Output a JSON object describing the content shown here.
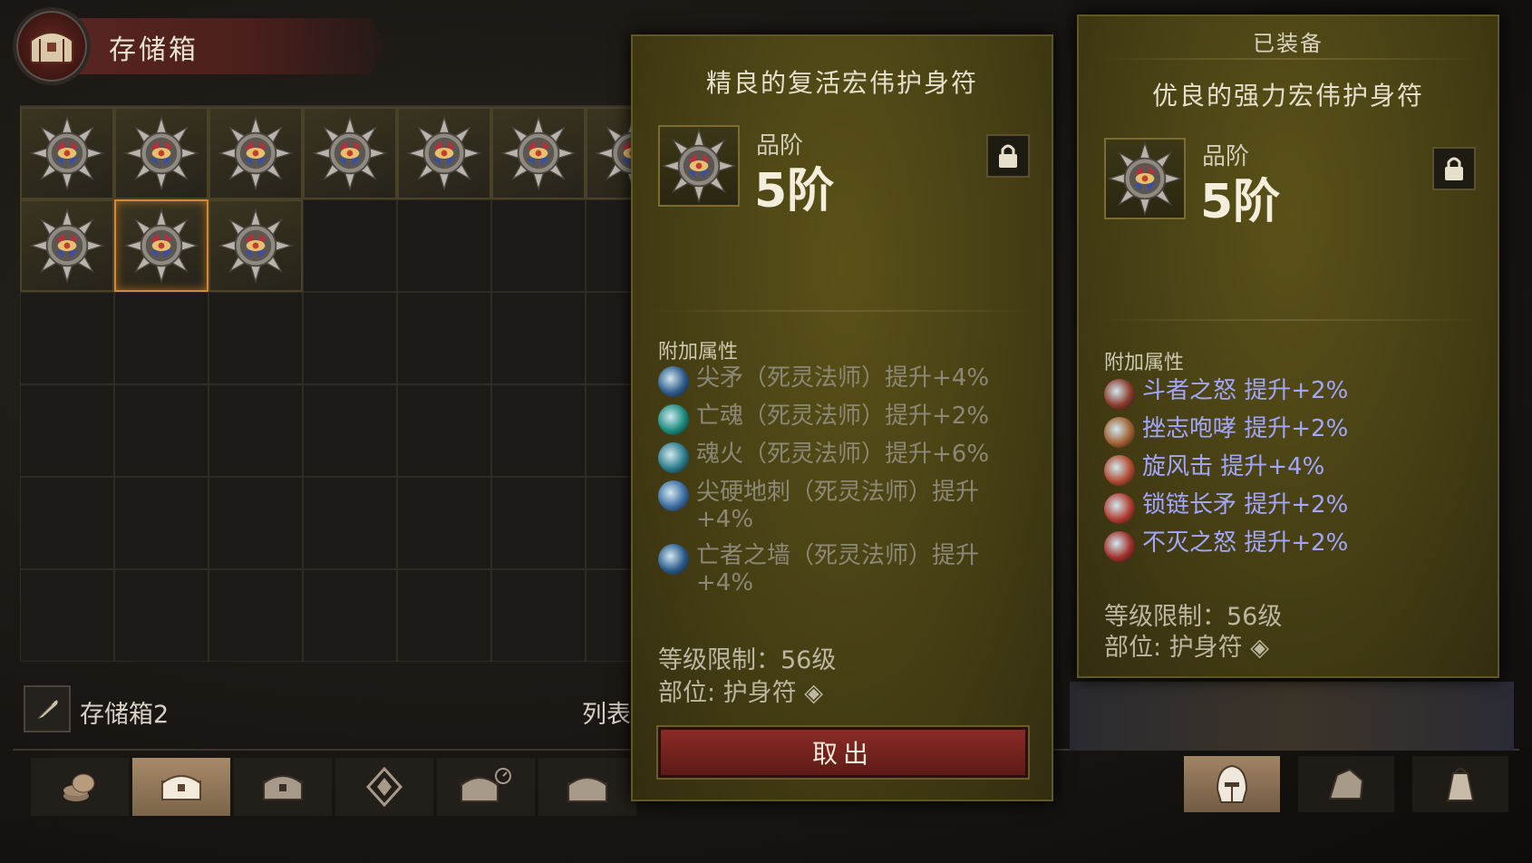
{
  "storage": {
    "title": "存储箱",
    "grid_rows": [
      [
        "amulet",
        "amulet",
        "amulet",
        "amulet",
        "amulet",
        "amulet",
        "amulet"
      ],
      [
        "amulet",
        "amulet-selected",
        "amulet",
        "empty",
        "empty",
        "empty",
        "empty"
      ]
    ],
    "footer_name": "存储箱2",
    "list_label": "列表"
  },
  "tabs": [
    {
      "icon": "coins-icon"
    },
    {
      "icon": "chest-icon",
      "active": true
    },
    {
      "icon": "chest-icon"
    },
    {
      "icon": "gem-icon"
    },
    {
      "icon": "chest-timer-icon"
    },
    {
      "icon": "chest-icon"
    }
  ],
  "equip_tabs": [
    {
      "icon": "helmet-icon",
      "active": true
    },
    {
      "icon": "ore-icon"
    },
    {
      "icon": "bag-icon"
    }
  ],
  "left_item": {
    "name": "精良的复活宏伟护身符",
    "tier_label": "品阶",
    "tier_value": "5阶",
    "attr_heading": "附加属性",
    "attributes": [
      {
        "icon": "spear-icon",
        "text": "尖矛（死灵法师）提升+4%"
      },
      {
        "icon": "soul-icon",
        "text": "亡魂（死灵法师）提升+2%"
      },
      {
        "icon": "soulfire-icon",
        "text": "魂火（死灵法师）提升+6%"
      },
      {
        "icon": "ground-spike-icon",
        "text": "尖硬地刺（死灵法师）提升+4%"
      },
      {
        "icon": "bone-wall-icon",
        "text": "亡者之墙（死灵法师）提升+4%"
      }
    ],
    "level_req": "等级限制：56级",
    "slot": "部位: 护身符",
    "action_button": "取出"
  },
  "right_item": {
    "equipped_label": "已装备",
    "name": "优良的强力宏伟护身符",
    "tier_label": "品阶",
    "tier_value": "5阶",
    "attr_heading": "附加属性",
    "attributes": [
      {
        "icon": "rage-icon",
        "text": "斗者之怒  提升+2%"
      },
      {
        "icon": "roar-icon",
        "text": "挫志咆哮  提升+2%"
      },
      {
        "icon": "whirlwind-icon",
        "text": "旋风击  提升+4%"
      },
      {
        "icon": "chain-spear-icon",
        "text": "锁链长矛  提升+2%"
      },
      {
        "icon": "undying-icon",
        "text": "不灭之怒  提升+2%"
      }
    ],
    "level_req": "等级限制：56级",
    "slot": "部位: 护身符"
  },
  "colors": {
    "panel_bg": "#463f14",
    "attr_blue": "#a2a6ff",
    "attr_gray": "#8d8876",
    "button_red": "#8a2b25",
    "selected_border": "#d08a3a"
  }
}
